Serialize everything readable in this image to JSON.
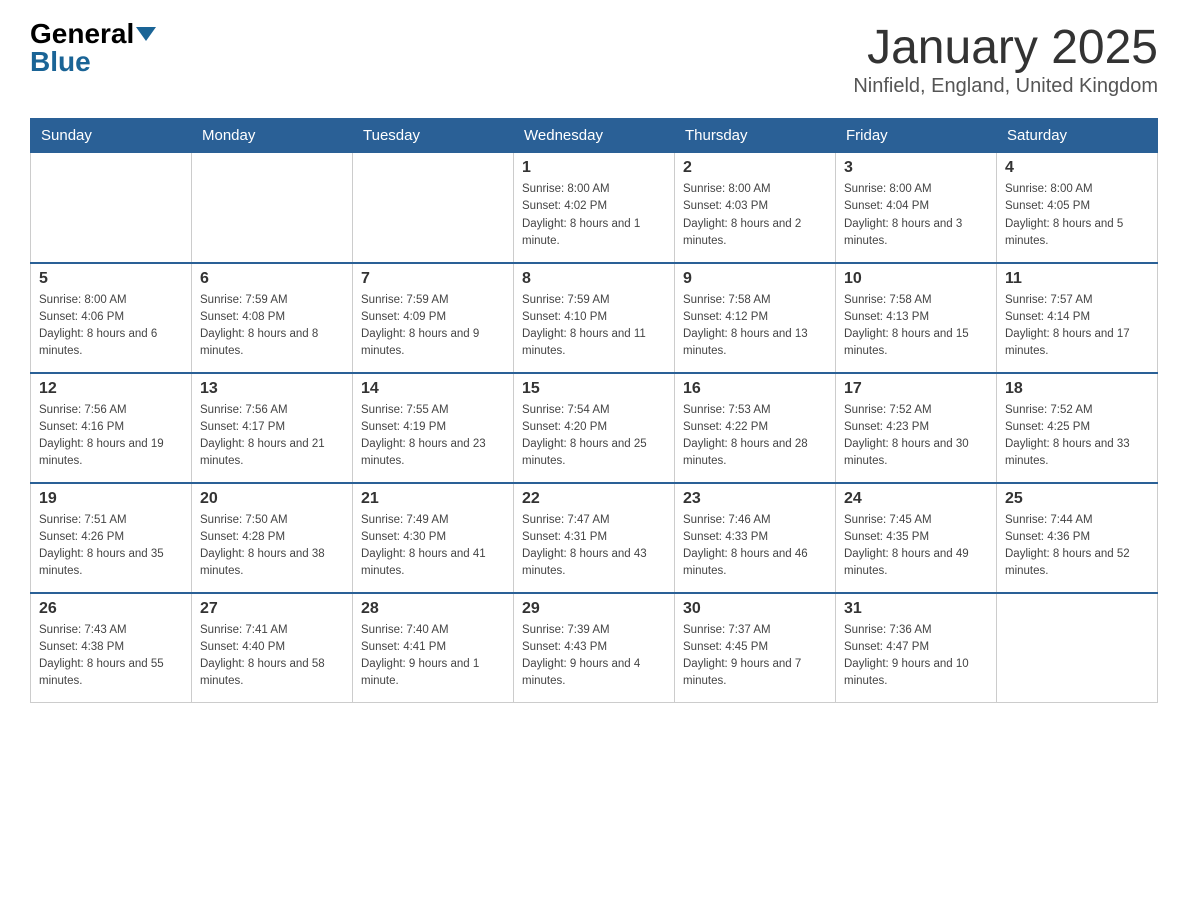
{
  "header": {
    "logo_general": "General",
    "logo_blue": "Blue",
    "title": "January 2025",
    "subtitle": "Ninfield, England, United Kingdom"
  },
  "weekdays": [
    "Sunday",
    "Monday",
    "Tuesday",
    "Wednesday",
    "Thursday",
    "Friday",
    "Saturday"
  ],
  "weeks": [
    [
      {
        "day": "",
        "info": ""
      },
      {
        "day": "",
        "info": ""
      },
      {
        "day": "",
        "info": ""
      },
      {
        "day": "1",
        "info": "Sunrise: 8:00 AM\nSunset: 4:02 PM\nDaylight: 8 hours and 1 minute."
      },
      {
        "day": "2",
        "info": "Sunrise: 8:00 AM\nSunset: 4:03 PM\nDaylight: 8 hours and 2 minutes."
      },
      {
        "day": "3",
        "info": "Sunrise: 8:00 AM\nSunset: 4:04 PM\nDaylight: 8 hours and 3 minutes."
      },
      {
        "day": "4",
        "info": "Sunrise: 8:00 AM\nSunset: 4:05 PM\nDaylight: 8 hours and 5 minutes."
      }
    ],
    [
      {
        "day": "5",
        "info": "Sunrise: 8:00 AM\nSunset: 4:06 PM\nDaylight: 8 hours and 6 minutes."
      },
      {
        "day": "6",
        "info": "Sunrise: 7:59 AM\nSunset: 4:08 PM\nDaylight: 8 hours and 8 minutes."
      },
      {
        "day": "7",
        "info": "Sunrise: 7:59 AM\nSunset: 4:09 PM\nDaylight: 8 hours and 9 minutes."
      },
      {
        "day": "8",
        "info": "Sunrise: 7:59 AM\nSunset: 4:10 PM\nDaylight: 8 hours and 11 minutes."
      },
      {
        "day": "9",
        "info": "Sunrise: 7:58 AM\nSunset: 4:12 PM\nDaylight: 8 hours and 13 minutes."
      },
      {
        "day": "10",
        "info": "Sunrise: 7:58 AM\nSunset: 4:13 PM\nDaylight: 8 hours and 15 minutes."
      },
      {
        "day": "11",
        "info": "Sunrise: 7:57 AM\nSunset: 4:14 PM\nDaylight: 8 hours and 17 minutes."
      }
    ],
    [
      {
        "day": "12",
        "info": "Sunrise: 7:56 AM\nSunset: 4:16 PM\nDaylight: 8 hours and 19 minutes."
      },
      {
        "day": "13",
        "info": "Sunrise: 7:56 AM\nSunset: 4:17 PM\nDaylight: 8 hours and 21 minutes."
      },
      {
        "day": "14",
        "info": "Sunrise: 7:55 AM\nSunset: 4:19 PM\nDaylight: 8 hours and 23 minutes."
      },
      {
        "day": "15",
        "info": "Sunrise: 7:54 AM\nSunset: 4:20 PM\nDaylight: 8 hours and 25 minutes."
      },
      {
        "day": "16",
        "info": "Sunrise: 7:53 AM\nSunset: 4:22 PM\nDaylight: 8 hours and 28 minutes."
      },
      {
        "day": "17",
        "info": "Sunrise: 7:52 AM\nSunset: 4:23 PM\nDaylight: 8 hours and 30 minutes."
      },
      {
        "day": "18",
        "info": "Sunrise: 7:52 AM\nSunset: 4:25 PM\nDaylight: 8 hours and 33 minutes."
      }
    ],
    [
      {
        "day": "19",
        "info": "Sunrise: 7:51 AM\nSunset: 4:26 PM\nDaylight: 8 hours and 35 minutes."
      },
      {
        "day": "20",
        "info": "Sunrise: 7:50 AM\nSunset: 4:28 PM\nDaylight: 8 hours and 38 minutes."
      },
      {
        "day": "21",
        "info": "Sunrise: 7:49 AM\nSunset: 4:30 PM\nDaylight: 8 hours and 41 minutes."
      },
      {
        "day": "22",
        "info": "Sunrise: 7:47 AM\nSunset: 4:31 PM\nDaylight: 8 hours and 43 minutes."
      },
      {
        "day": "23",
        "info": "Sunrise: 7:46 AM\nSunset: 4:33 PM\nDaylight: 8 hours and 46 minutes."
      },
      {
        "day": "24",
        "info": "Sunrise: 7:45 AM\nSunset: 4:35 PM\nDaylight: 8 hours and 49 minutes."
      },
      {
        "day": "25",
        "info": "Sunrise: 7:44 AM\nSunset: 4:36 PM\nDaylight: 8 hours and 52 minutes."
      }
    ],
    [
      {
        "day": "26",
        "info": "Sunrise: 7:43 AM\nSunset: 4:38 PM\nDaylight: 8 hours and 55 minutes."
      },
      {
        "day": "27",
        "info": "Sunrise: 7:41 AM\nSunset: 4:40 PM\nDaylight: 8 hours and 58 minutes."
      },
      {
        "day": "28",
        "info": "Sunrise: 7:40 AM\nSunset: 4:41 PM\nDaylight: 9 hours and 1 minute."
      },
      {
        "day": "29",
        "info": "Sunrise: 7:39 AM\nSunset: 4:43 PM\nDaylight: 9 hours and 4 minutes."
      },
      {
        "day": "30",
        "info": "Sunrise: 7:37 AM\nSunset: 4:45 PM\nDaylight: 9 hours and 7 minutes."
      },
      {
        "day": "31",
        "info": "Sunrise: 7:36 AM\nSunset: 4:47 PM\nDaylight: 9 hours and 10 minutes."
      },
      {
        "day": "",
        "info": ""
      }
    ]
  ]
}
